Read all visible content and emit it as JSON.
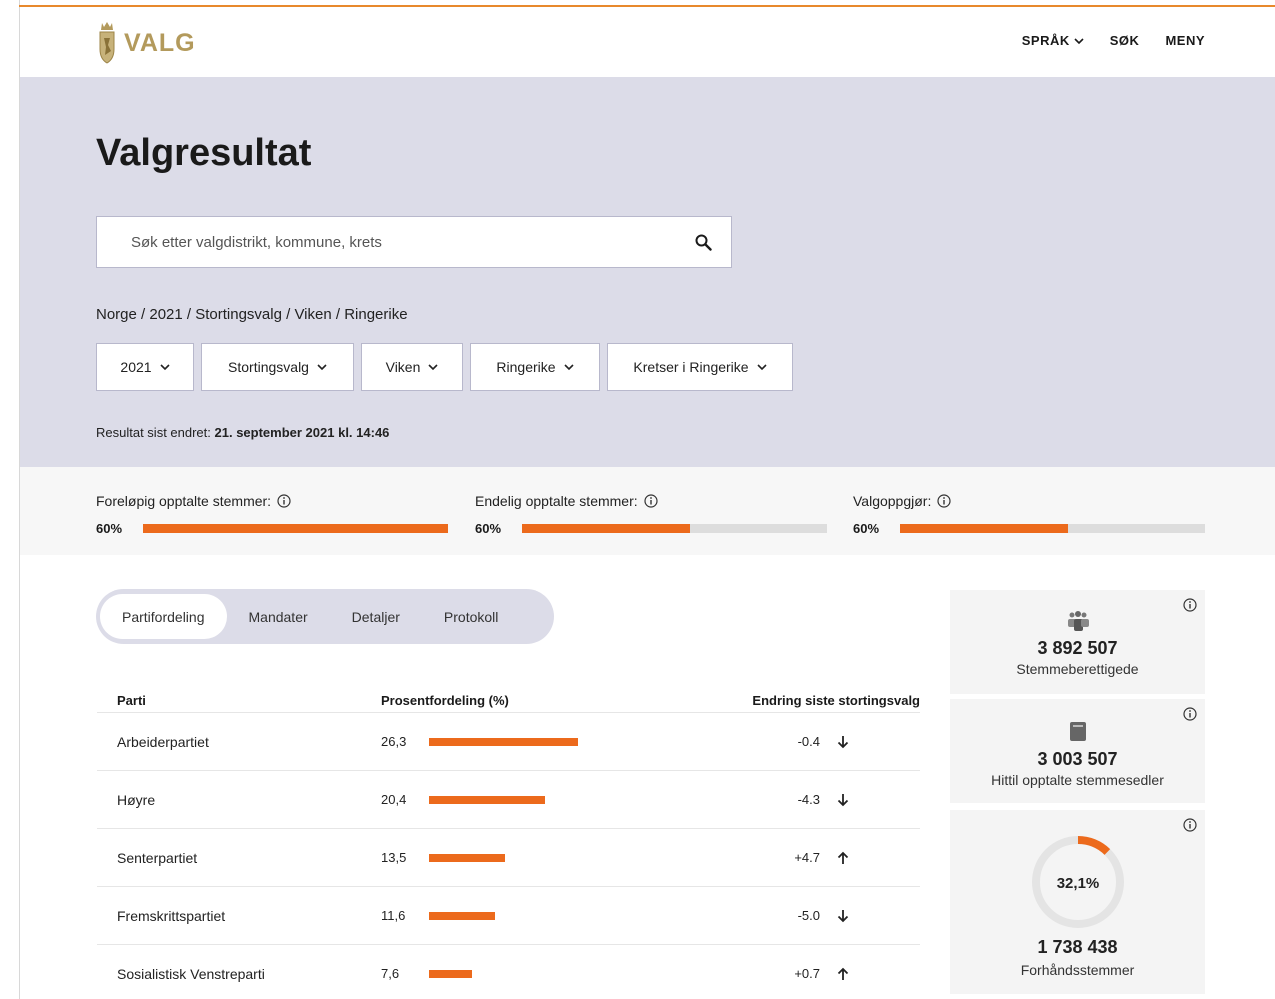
{
  "header": {
    "logo_text": "VALG",
    "nav": {
      "language": "SPRÅK",
      "search": "SØK",
      "menu": "MENY"
    }
  },
  "hero": {
    "title": "Valgresultat",
    "search_placeholder": "Søk etter valgdistrikt, kommune, krets",
    "breadcrumb": "Norge / 2021 / Stortingsvalg / Viken / Ringerike",
    "filters": [
      "2021",
      "Stortingsvalg",
      "Viken",
      "Ringerike",
      "Kretser i Ringerike"
    ],
    "updated_label": "Resultat sist endret:",
    "updated_value": "21. september 2021 kl. 14:46"
  },
  "progress": [
    {
      "label": "Foreløpig opptalte stemmer:",
      "pct_text": "60%",
      "fill": 1.0
    },
    {
      "label": "Endelig opptalte stemmer:",
      "pct_text": "60%",
      "fill": 0.55
    },
    {
      "label": "Valgoppgjør:",
      "pct_text": "60%",
      "fill": 0.55
    }
  ],
  "tabs": [
    "Partifordeling",
    "Mandater",
    "Detaljer",
    "Protokoll"
  ],
  "table": {
    "headers": {
      "party": "Parti",
      "pct": "Prosentfordeling (%)",
      "change": "Endring siste stortingsvalg"
    },
    "rows": [
      {
        "party": "Arbeiderpartiet",
        "pct": "26,3",
        "value": 26.3,
        "change": "-0.4",
        "direction": "down"
      },
      {
        "party": "Høyre",
        "pct": "20,4",
        "value": 20.4,
        "change": "-4.3",
        "direction": "down"
      },
      {
        "party": "Senterpartiet",
        "pct": "13,5",
        "value": 13.5,
        "change": "+4.7",
        "direction": "up"
      },
      {
        "party": "Fremskrittspartiet",
        "pct": "11,6",
        "value": 11.6,
        "change": "-5.0",
        "direction": "down"
      },
      {
        "party": "Sosialistisk Venstreparti",
        "pct": "7,6",
        "value": 7.6,
        "change": "+0.7",
        "direction": "up"
      }
    ]
  },
  "cards": {
    "eligible": {
      "value": "3 892 507",
      "label": "Stemmeberettigede"
    },
    "counted": {
      "value": "3 003 507",
      "label": "Hittil opptalte stemmesedler"
    },
    "advance": {
      "value": "1 738 438",
      "label": "Forhåndsstemmer",
      "donut_text": "32,1%",
      "donut_fraction": 0.123
    }
  },
  "colors": {
    "accent": "#ec6a1c",
    "hero_bg": "#dcdce8",
    "logo_gold": "#b39a5c"
  }
}
